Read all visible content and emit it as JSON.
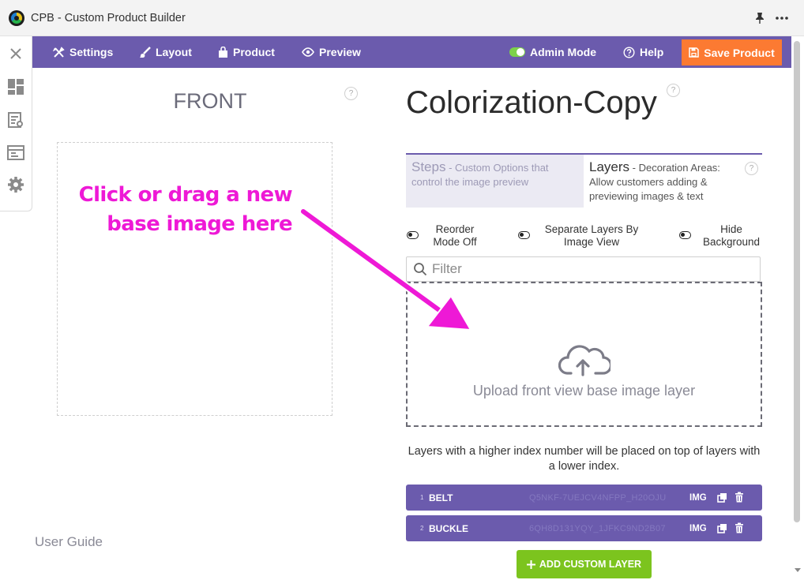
{
  "window": {
    "title": "CPB - Custom Product Builder"
  },
  "nav": {
    "settings": "Settings",
    "layout": "Layout",
    "product": "Product",
    "preview": "Preview",
    "admin_mode": "Admin Mode",
    "help": "Help",
    "save": "Save Product"
  },
  "preview": {
    "view_title": "FRONT",
    "user_guide": "User Guide"
  },
  "annotation": {
    "line1": "Click or drag a new",
    "line2": "base image here",
    "color": "#ee19d6"
  },
  "product": {
    "title": "Colorization-Copy"
  },
  "tabs": {
    "steps": {
      "label": "Steps",
      "desc": " - Custom Options that control the image preview"
    },
    "layers": {
      "label": "Layers",
      "desc": " - Decoration Areas: Allow customers adding & previewing images & text"
    }
  },
  "options": {
    "reorder": "Reorder Mode Off",
    "separate": "Separate Layers By Image View",
    "hide_bg": "Hide Background"
  },
  "filter": {
    "placeholder": "Filter"
  },
  "upload": {
    "text": "Upload front view base image layer"
  },
  "layers_note": "Layers with a higher index number will be placed on top of layers with a lower index.",
  "layers": [
    {
      "index": "1",
      "name": "BELT",
      "id": "Q5NKF-7UEJCV4NFPP_H20OJU",
      "type": "IMG"
    },
    {
      "index": "2",
      "name": "BUCKLE",
      "id": "6QH8D131YQY_1JFKC9ND2B07",
      "type": "IMG"
    }
  ],
  "add_layer": "ADD CUSTOM LAYER",
  "help_glyph": "?",
  "colors": {
    "nav": "#6b5bad",
    "save": "#fc7a32",
    "add": "#7cc41e",
    "toggle_on": "#7cd14a"
  }
}
